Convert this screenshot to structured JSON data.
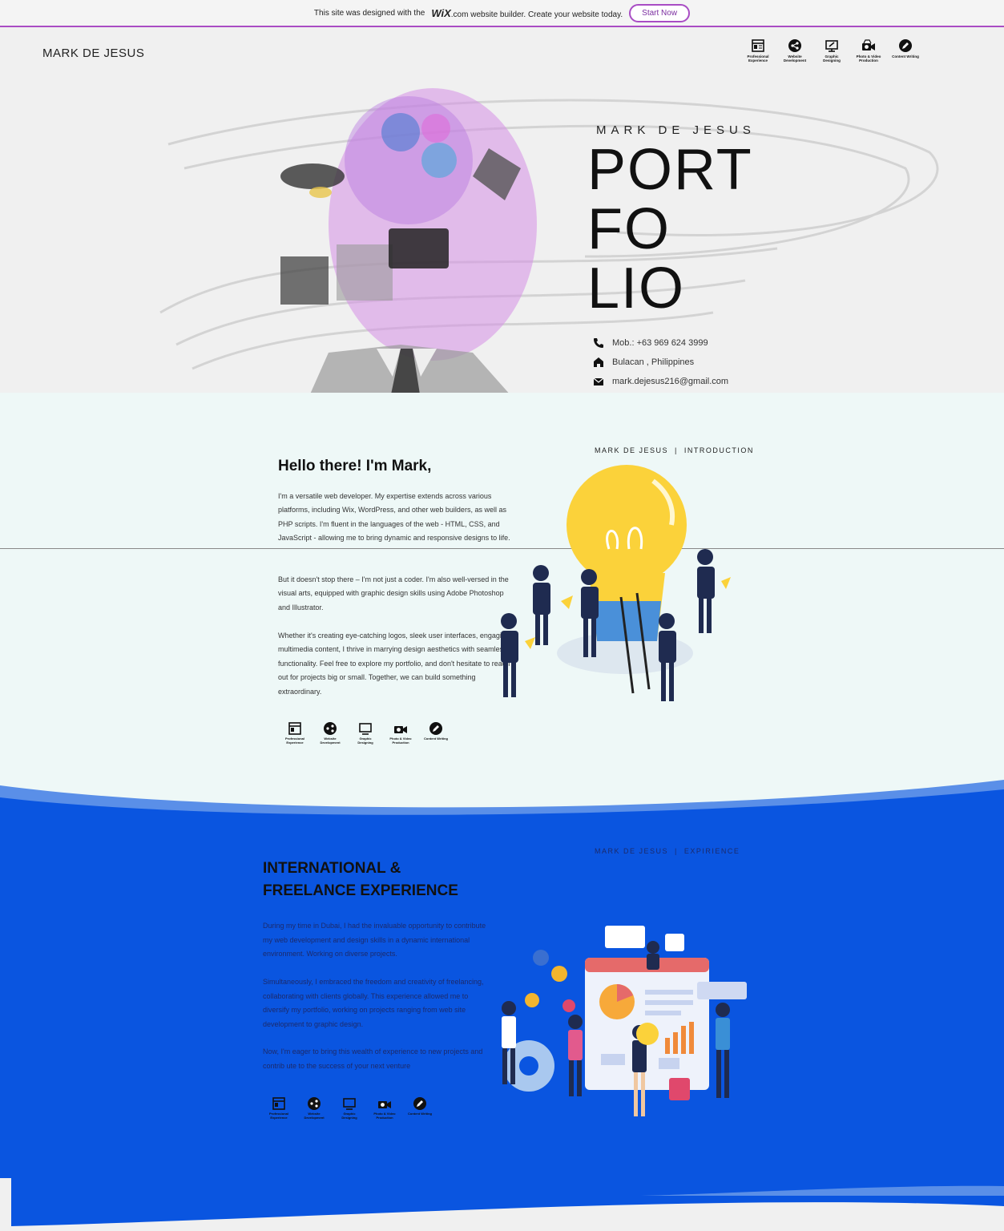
{
  "wix_banner": {
    "prefix": "This site was designed with the",
    "brand": "WiX",
    "suffix": ".com website builder. Create your website today.",
    "button": "Start Now"
  },
  "header": {
    "brand": "MARK DE JESUS",
    "nav": [
      {
        "icon": "professional-experience-icon",
        "label": "Professional Experience"
      },
      {
        "icon": "website-development-icon",
        "label": "Website Development"
      },
      {
        "icon": "graphic-designing-icon",
        "label": "Graphic Designing"
      },
      {
        "icon": "photo-video-production-icon",
        "label": "Photo & Video Production"
      },
      {
        "icon": "content-writing-icon",
        "label": "Content Writing"
      }
    ]
  },
  "hero": {
    "name": "MARK DE JESUS",
    "line1": "PORT",
    "line2": "FO",
    "line3": "LIO",
    "phone": "Mob.: +63 969 624 3999",
    "location": "Bulacan , Philippines",
    "email": "mark.dejesus216@gmail.com"
  },
  "intro": {
    "crumb_name": "MARK DE JESUS",
    "crumb_sep": "|",
    "crumb_section": "INTRODUCTION",
    "title": "Hello there! I'm Mark,",
    "p1": "I'm a versatile web developer. My expertise extends across various platforms, including Wix, WordPress, and other web builders, as well as PHP scripts. I'm fluent in the languages of the web - HTML, CSS, and JavaScript - allowing me to bring dynamic and responsive designs to life.",
    "p2": "But it doesn't stop there – I'm not just a coder. I'm also well-versed in the visual arts, equipped with graphic design skills using Adobe Photoshop and Illustrator.",
    "p3": "Whether it's creating eye-catching logos, sleek user interfaces, engaging multimedia content, I thrive in marrying design aesthetics with seamless functionality. Feel free to explore my portfolio, and don't hesitate to reach out for projects big or small. Together, we can build something extraordinary."
  },
  "experience": {
    "crumb_name": "MARK DE JESUS",
    "crumb_sep": "|",
    "crumb_section": "EXPIRIENCE",
    "title_line1": "INTERNATIONAL &",
    "title_line2": "FREELANCE EXPERIENCE",
    "p1": "During my time in Dubai, I had the invaluable opportunity to contribute my web development and design skills in a dynamic international environment. Working on diverse projects.",
    "p2": "Simultaneously, I embraced the freedom and creativity of freelancing, collaborating with clients globally. This experience allowed me to diversify my portfolio, working on projects ranging from web site development to graphic design.",
    "p3": "Now, I'm eager to bring this wealth of experience to new projects and contrib ute to the success of your next venture"
  },
  "colors": {
    "accent": "#a94dc4",
    "blue": "#0a55e0",
    "intro_bg": "#eef8f7",
    "bulb": "#fbd23a"
  }
}
